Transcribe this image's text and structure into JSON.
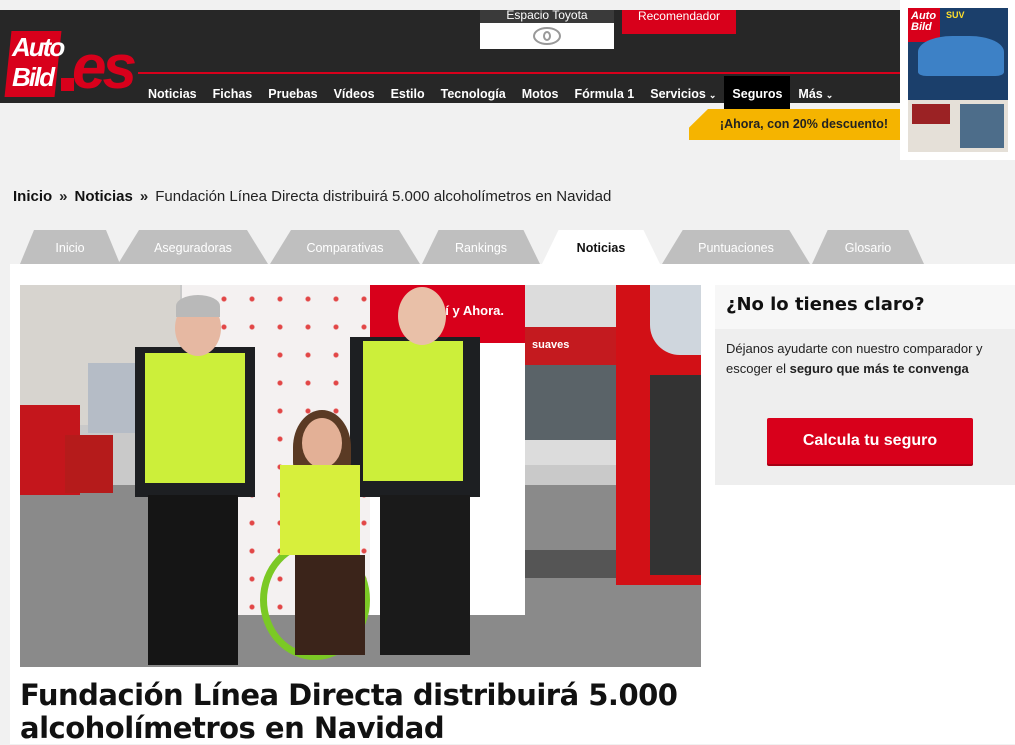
{
  "header": {
    "logo": {
      "line1": "Auto",
      "line2": "Bild",
      "suffix": "es"
    },
    "sponsor": {
      "label": "Espacio Toyota"
    },
    "recommender": "Recomendador",
    "nav": [
      {
        "label": "Noticias"
      },
      {
        "label": "Fichas"
      },
      {
        "label": "Pruebas"
      },
      {
        "label": "Vídeos"
      },
      {
        "label": "Estilo"
      },
      {
        "label": "Tecnología"
      },
      {
        "label": "Motos"
      },
      {
        "label": "Fórmula 1"
      },
      {
        "label": "Servicios",
        "caret": "⌄"
      },
      {
        "label": "Seguros",
        "active": true
      },
      {
        "label": "Más",
        "caret": "⌄"
      }
    ],
    "promo": "¡Ahora, con 20% descuento!",
    "magazine": {
      "title_line1": "Auto",
      "title_line2": "Bild",
      "kicker": "SUV"
    }
  },
  "breadcrumb": {
    "home": "Inicio",
    "section": "Noticias",
    "separator": "»",
    "current": "Fundación Línea Directa distribuirá 5.000 alcoholímetros en Navidad"
  },
  "tabs": [
    {
      "label": "Inicio"
    },
    {
      "label": "Aseguradoras"
    },
    {
      "label": "Comparativas"
    },
    {
      "label": "Rankings"
    },
    {
      "label": "Noticias",
      "active": true
    },
    {
      "label": "Puntuaciones"
    },
    {
      "label": "Glosario"
    }
  ],
  "article": {
    "photo_banner_text": "Aquí y Ahora.",
    "photo_station_text": "suaves",
    "headline": "Fundación Línea Directa distribuirá 5.000 alcoholímetros en Navidad"
  },
  "sidebar": {
    "title": "¿No lo tienes claro?",
    "text_before": "Déjanos ayudarte con nuestro comparador y escoger el ",
    "text_bold": "seguro que más te convenga",
    "button": "Calcula tu seguro"
  },
  "colors": {
    "brand_red": "#d8001b",
    "promo_yellow": "#f5b400",
    "dark_header": "#272727",
    "tab_grey": "#bfbfbf"
  }
}
